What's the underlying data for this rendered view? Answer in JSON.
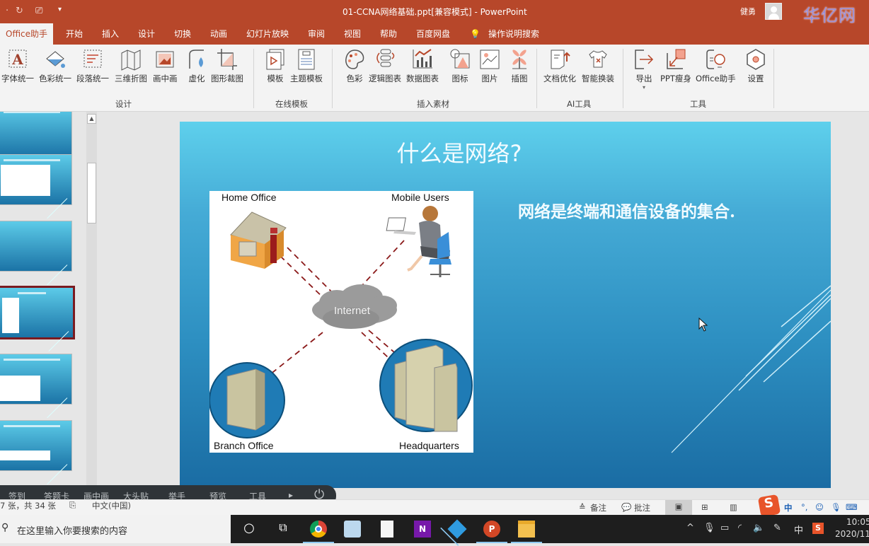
{
  "titlebar": {
    "title": "01-CCNA网络基础.ppt[兼容模式]  -  PowerPoint",
    "user": "健勇",
    "watermark": "华亿网络",
    "quick_access": [
      "undo",
      "redo",
      "present"
    ]
  },
  "tabs": [
    "Office助手",
    "开始",
    "插入",
    "设计",
    "切换",
    "动画",
    "幻灯片放映",
    "审阅",
    "视图",
    "帮助",
    "百度网盘",
    "操作说明搜索"
  ],
  "active_tab": "Office助手",
  "ribbon": {
    "groups": [
      {
        "label": "设计",
        "buttons": [
          "字体统一",
          "色彩统一",
          "段落统一",
          "三维折图",
          "画中画",
          "虚化",
          "图形裁图"
        ]
      },
      {
        "label": "在线模板",
        "buttons": [
          "模板",
          "主题模板"
        ]
      },
      {
        "label": "插入素材",
        "buttons": [
          "色彩",
          "逻辑图表",
          "数据图表",
          "图标",
          "图片",
          "插图"
        ]
      },
      {
        "label": "AI工具",
        "buttons": [
          "文档优化",
          "智能换装"
        ]
      },
      {
        "label": "工具",
        "buttons": [
          "导出",
          "PPT瘦身",
          "Office助手",
          "设置"
        ]
      }
    ]
  },
  "slide": {
    "title": "什么是网络?",
    "body": "网络是终端和通信设备的集合.",
    "diagram": {
      "labels": {
        "home": "Home Office",
        "mobile": "Mobile Users",
        "internet": "Internet",
        "branch": "Branch Office",
        "hq": "Headquarters"
      }
    }
  },
  "thumbnails": {
    "count_visible": 6,
    "selected_index": 3
  },
  "floatbar": {
    "items": [
      "签到",
      "答题卡",
      "画中画",
      "大头贴",
      "举手",
      "预览",
      "工具"
    ]
  },
  "statusbar": {
    "slide_info": "7 张，共 34 张",
    "language": "中文(中国)",
    "notes": "备注",
    "comments": "批注"
  },
  "taskbar": {
    "search_placeholder": "在这里输入你要搜索的内容",
    "time": "10:05",
    "date": "2020/11/",
    "ime": "中"
  },
  "colors": {
    "accent": "#b7472a",
    "selected_thumb": "#7b1b20"
  }
}
